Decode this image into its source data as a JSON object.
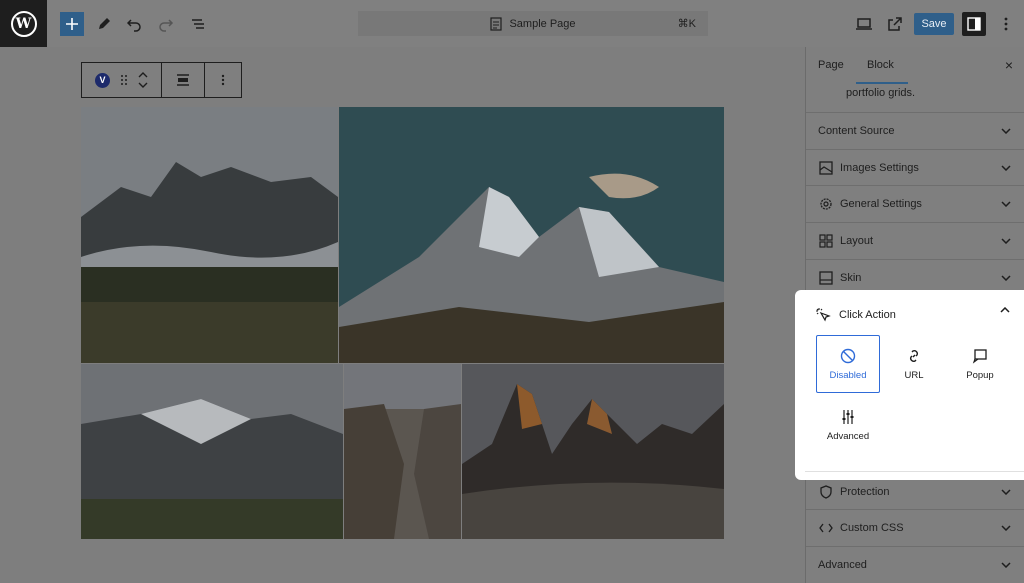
{
  "topbar": {
    "logo_letter": "W",
    "command": {
      "label": "Sample Page",
      "shortcut": "⌘K"
    },
    "save_label": "Save",
    "colors": {
      "accent": "#2f5f8a",
      "dark": "#1e1e1e"
    }
  },
  "block_toolbar": {
    "badge": "V"
  },
  "sidebar": {
    "tabs": [
      {
        "label": "Page"
      },
      {
        "label": "Block"
      }
    ],
    "close": "×",
    "intro_text": "portfolio grids.",
    "panels": [
      {
        "label": "Content Source",
        "icon": ""
      },
      {
        "label": "Images Settings",
        "icon": "images-icon"
      },
      {
        "label": "General Settings",
        "icon": "gear-icon"
      },
      {
        "label": "Layout",
        "icon": "layout-grid-icon"
      },
      {
        "label": "Skin",
        "icon": "skin-icon"
      }
    ],
    "click_action": {
      "title": "Click Action",
      "options": [
        {
          "label": "Disabled",
          "icon": "disabled-icon",
          "selected": true
        },
        {
          "label": "URL",
          "icon": "link-icon",
          "selected": false
        },
        {
          "label": "Popup",
          "icon": "popup-icon",
          "selected": false
        },
        {
          "label": "Advanced",
          "icon": "sliders-icon",
          "selected": false
        }
      ]
    },
    "bottom_panels": [
      {
        "label": "Protection",
        "icon": "shield-icon"
      },
      {
        "label": "Custom CSS",
        "icon": "code-icon"
      },
      {
        "label": "Advanced",
        "icon": ""
      }
    ]
  }
}
